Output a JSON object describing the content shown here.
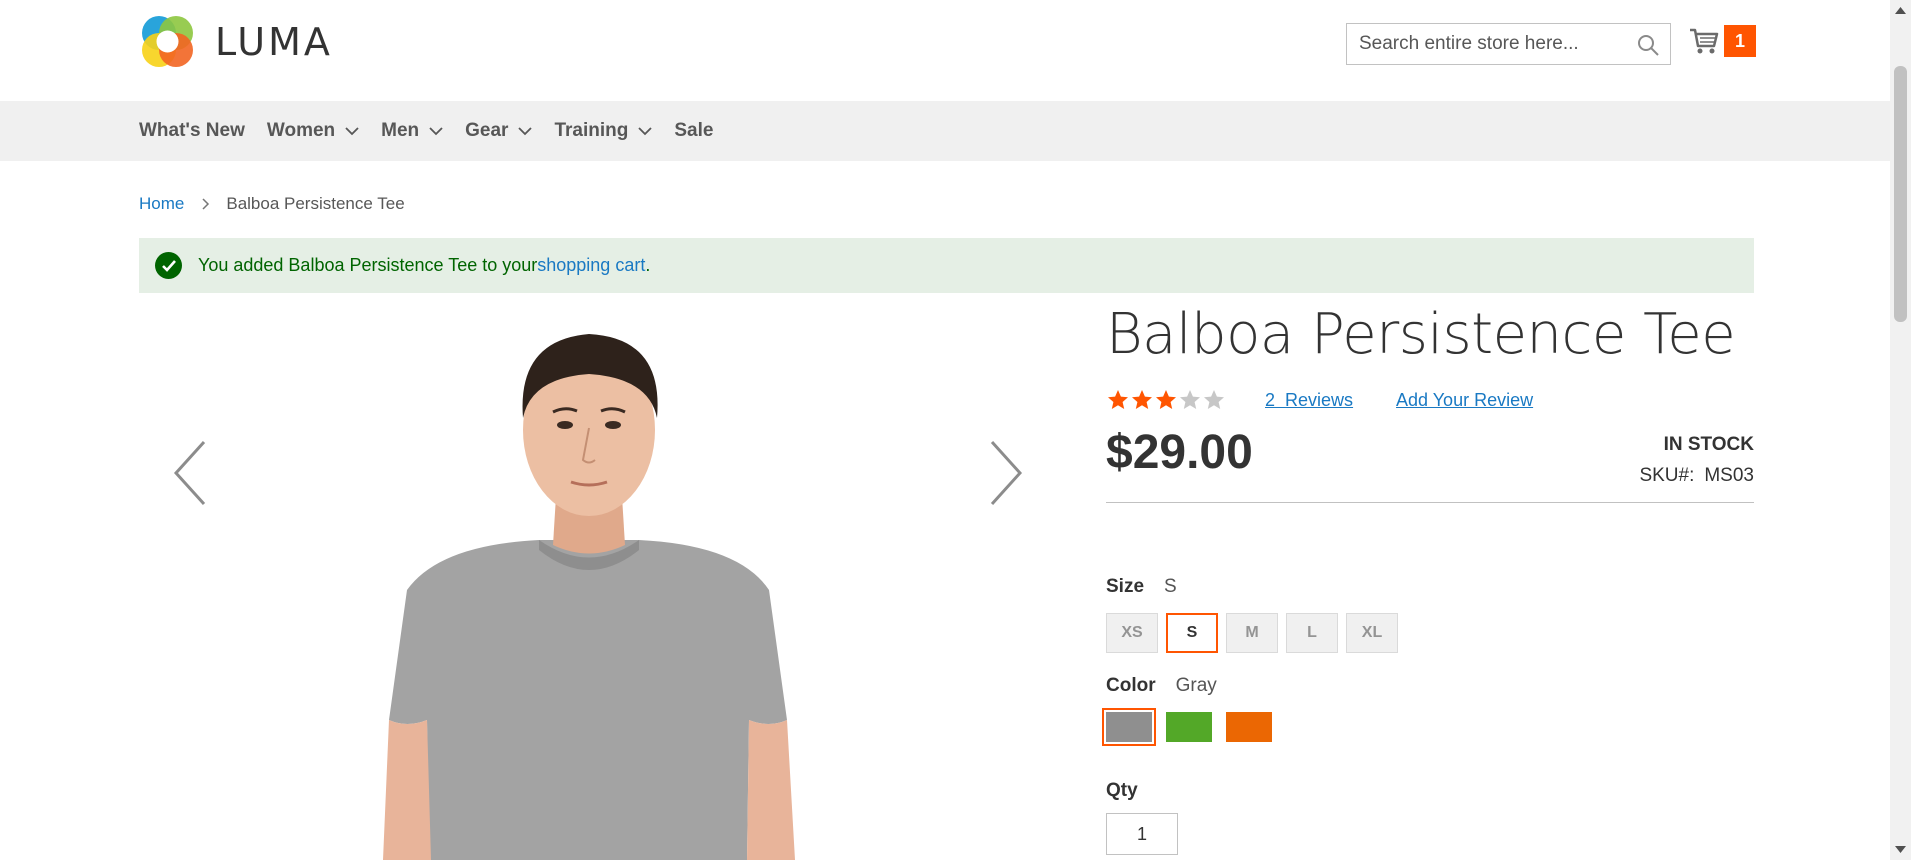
{
  "header": {
    "logo_text": "LUMA",
    "search_placeholder": "Search entire store here...",
    "cart_count": "1"
  },
  "nav": {
    "items": [
      {
        "label": "What's New",
        "has_dropdown": false
      },
      {
        "label": "Women",
        "has_dropdown": true
      },
      {
        "label": "Men",
        "has_dropdown": true
      },
      {
        "label": "Gear",
        "has_dropdown": true
      },
      {
        "label": "Training",
        "has_dropdown": true
      },
      {
        "label": "Sale",
        "has_dropdown": false
      }
    ]
  },
  "breadcrumb": {
    "home": "Home",
    "current": "Balboa Persistence Tee"
  },
  "message": {
    "prefix": "You added Balboa Persistence Tee to your ",
    "link": "shopping cart",
    "suffix": "."
  },
  "product": {
    "title": "Balboa Persistence Tee",
    "rating_stars": 3,
    "rating_max": 5,
    "reviews_count": "2",
    "reviews_label": "Reviews",
    "add_review": "Add Your Review",
    "price": "$29.00",
    "stock": "IN STOCK",
    "sku_label": "SKU#:",
    "sku": "MS03",
    "size_label": "Size",
    "size_selected": "S",
    "sizes": [
      "XS",
      "S",
      "M",
      "L",
      "XL"
    ],
    "color_label": "Color",
    "color_selected": "Gray",
    "colors": [
      {
        "name": "Gray",
        "hex": "#8f8f8f"
      },
      {
        "name": "Green",
        "hex": "#53a828"
      },
      {
        "name": "Orange",
        "hex": "#eb6703"
      }
    ],
    "qty_label": "Qty",
    "qty_value": "1"
  },
  "colors": {
    "accent": "#ff5501",
    "link": "#1979c3",
    "success_bg": "#e5efe5",
    "success_text": "#006400",
    "star_filled": "#ff5501",
    "star_empty": "#c7c7c7"
  }
}
